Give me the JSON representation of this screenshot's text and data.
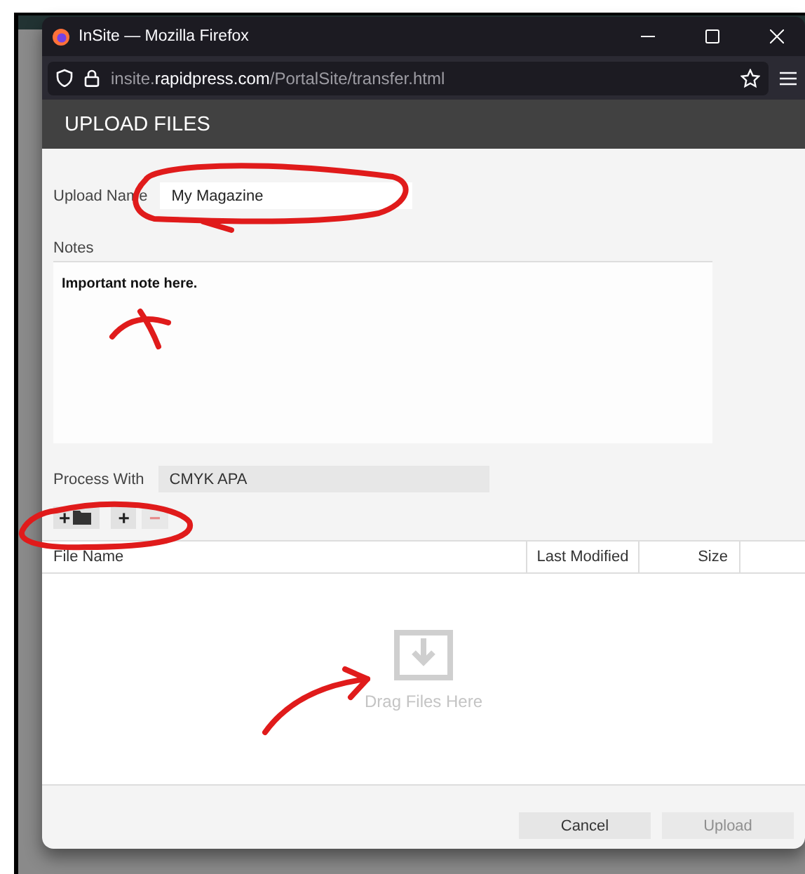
{
  "window": {
    "title": "InSite — Mozilla Firefox"
  },
  "address_bar": {
    "url_prefix": "insite.",
    "url_domain": "rapidpress.com",
    "url_path": "/PortalSite/transfer.html"
  },
  "dialog": {
    "title": "UPLOAD FILES",
    "upload_name": {
      "label": "Upload Name",
      "value": "My Magazine"
    },
    "notes": {
      "label": "Notes",
      "value": "Important note here."
    },
    "process_with": {
      "label": "Process With",
      "value": "CMYK APA"
    },
    "toolbar": [
      {
        "kind": "add-folder",
        "glyph": "+",
        "disabled": false
      },
      {
        "kind": "add",
        "glyph": "+",
        "disabled": false
      },
      {
        "kind": "remove",
        "glyph": "−",
        "disabled": true
      }
    ],
    "table": {
      "columns": [
        "File Name",
        "Last Modified",
        "Size"
      ],
      "drop_hint": "Drag Files Here"
    },
    "buttons": [
      {
        "label": "Cancel",
        "disabled": false
      },
      {
        "label": "Upload",
        "disabled": true
      }
    ]
  }
}
